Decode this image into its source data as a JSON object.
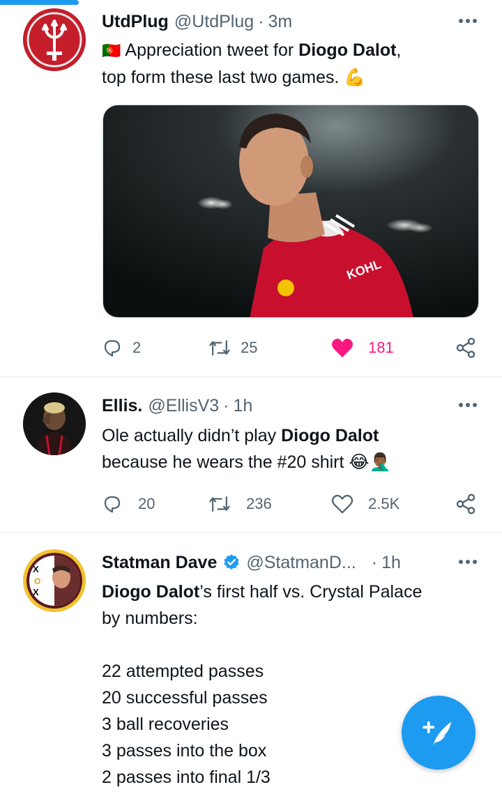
{
  "tweets": [
    {
      "name": "UtdPlug",
      "handle": "@UtdPlug",
      "sep": "·",
      "time": "3m",
      "flag": "🇵🇹",
      "text_pre": "Appreciation tweet for ",
      "text_bold": "Diogo Dalot",
      "text_post": ",",
      "text_line2": "top form these last two games.",
      "emoji": "💪",
      "replies": "2",
      "retweets": "25",
      "likes": "181",
      "liked": true
    },
    {
      "name": "Ellis.",
      "handle": "@EllisV3",
      "sep": "·",
      "time": "1h",
      "text_pre": "Ole actually didn’t play ",
      "text_bold": "Diogo Dalot",
      "text_line2": "because he wears the #20 shirt",
      "emoji": "😂🤦🏾‍♂️",
      "replies": "20",
      "retweets": "236",
      "likes": "2.5K",
      "liked": false
    },
    {
      "name": "Statman Dave",
      "handle": "@StatmanD...",
      "sep": "·",
      "time": "1h",
      "text_bold": "Diogo Dalot",
      "text_post": "’s first half vs. Crystal Palace",
      "text_line2": "by numbers:",
      "stats": [
        "22 attempted passes",
        "20 successful passes",
        "3 ball recoveries",
        "3 passes into the box",
        "2 passes into final 1/3"
      ]
    }
  ],
  "icons": {
    "more": "more-horizontal-icon",
    "reply": "reply-icon",
    "retweet": "retweet-icon",
    "like": "heart-icon",
    "share": "share-icon",
    "compose": "compose-tweet-icon",
    "verified": "verified-badge-icon"
  },
  "colors": {
    "accent": "#1d9bf0",
    "like": "#f91880",
    "muted": "#536471"
  }
}
